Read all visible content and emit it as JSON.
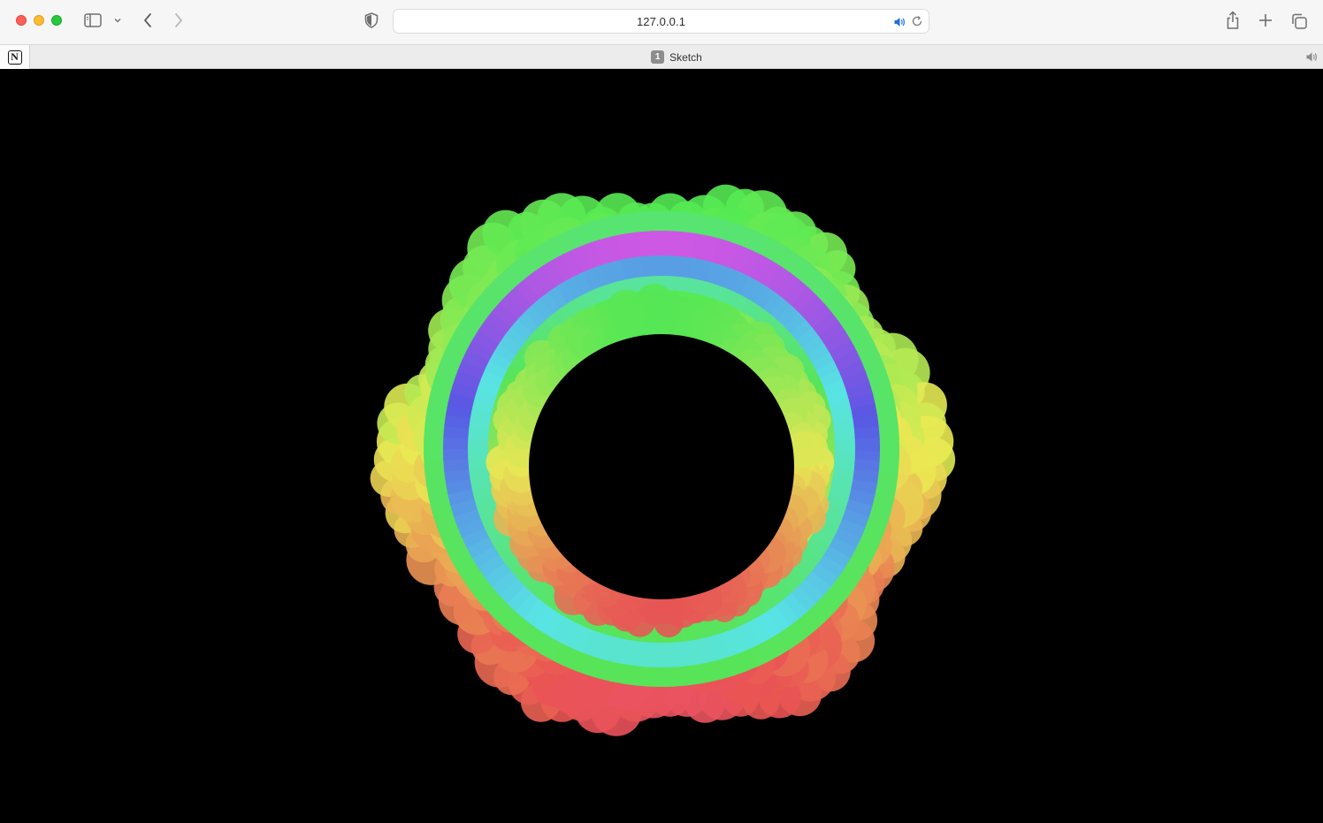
{
  "browser": {
    "url": "127.0.0.1",
    "tabs": [
      {
        "kind": "pinned",
        "icon": "notion-logo-icon",
        "logo_text": "N"
      },
      {
        "kind": "active",
        "badge": "1",
        "label": "Sketch",
        "audio": "speaker-icon"
      }
    ]
  },
  "sketch": {
    "background": "#000000",
    "palette": [
      "#e0e060",
      "#5ce070",
      "#50e0e0",
      "#5078e0",
      "#9050e0",
      "#e058e0",
      "#e85060",
      "#e89050"
    ]
  }
}
